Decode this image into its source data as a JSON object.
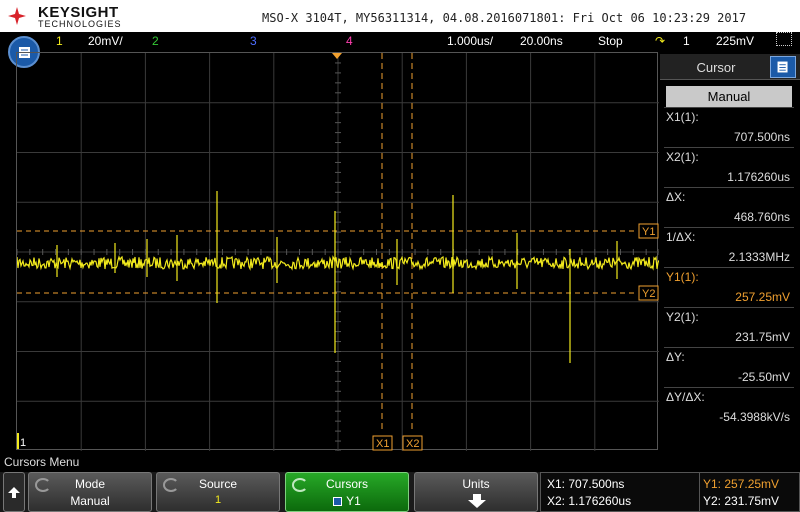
{
  "header": {
    "brand": "KEYSIGHT",
    "brand_sub": "TECHNOLOGIES",
    "title": "MSO-X 3104T, MY56311314, 04.08.2016071801: Fri Oct 06 10:23:29 2017"
  },
  "statusbar": {
    "ch1_num": "1",
    "ch1_scale": "20mV/",
    "ch2_num": "2",
    "ch3_num": "3",
    "ch4_num": "4",
    "timebase": "1.000us/",
    "delay": "20.00ns",
    "run_state": "Stop",
    "trigger_source": "1",
    "trigger_level": "225mV"
  },
  "colors": {
    "ch1": "#f2ea1d",
    "ch2": "#35c935",
    "ch3": "#4d6dff",
    "ch4": "#ff3fb0",
    "cursor": "#f0a030",
    "accent": "#1b5aa8"
  },
  "scope": {
    "ground_marker": "1",
    "trigger_marker": "T",
    "cursor_tags": {
      "x1": "X1",
      "x2": "X2",
      "y1": "Y1",
      "y2": "Y2"
    }
  },
  "panel": {
    "title": "Cursor",
    "mode_value": "Manual",
    "rows": [
      {
        "label": "X1(1):",
        "value": "707.500ns"
      },
      {
        "label": "X2(1):",
        "value": "1.176260us"
      },
      {
        "label": "ΔX:",
        "value": "468.760ns"
      },
      {
        "label": "1/ΔX:",
        "value": "2.1333MHz"
      },
      {
        "label": "Y1(1):",
        "value": "257.25mV"
      },
      {
        "label": "Y2(1):",
        "value": "231.75mV"
      },
      {
        "label": "ΔY:",
        "value": "-25.50mV"
      },
      {
        "label": "ΔY/ΔX:",
        "value": "-54.3988kV/s"
      }
    ]
  },
  "menu": {
    "name": "Cursors Menu",
    "keys": [
      {
        "title": "Mode",
        "value": "Manual"
      },
      {
        "title": "Source",
        "value": "1"
      },
      {
        "title": "Cursors",
        "value": "Y1"
      },
      {
        "title": "Units",
        "value": ""
      }
    ]
  },
  "readout": {
    "x1": "X1: 707.500ns",
    "x2": "X2: 1.176260us",
    "y1": "Y1: 257.25mV",
    "y2": "Y2: 231.75mV"
  }
}
